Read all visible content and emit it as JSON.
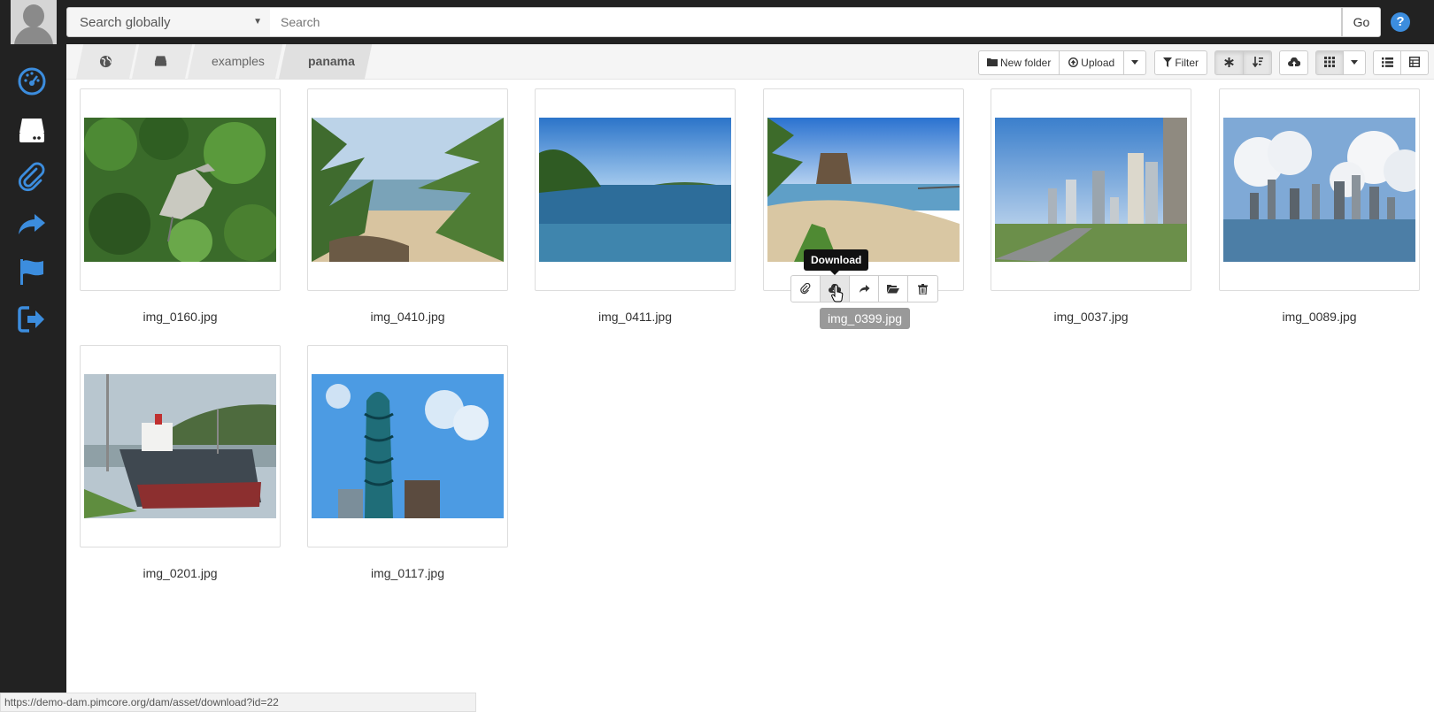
{
  "search": {
    "scope_label": "Search globally",
    "placeholder": "Search",
    "go_label": "Go",
    "help_label": "?"
  },
  "sidebar": {
    "items": [
      {
        "icon": "dashboard-icon"
      },
      {
        "icon": "drive-icon"
      },
      {
        "icon": "paperclip-icon"
      },
      {
        "icon": "share-icon"
      },
      {
        "icon": "flag-icon"
      },
      {
        "icon": "logout-icon"
      }
    ]
  },
  "breadcrumb": {
    "items": [
      {
        "icon": "globe-icon"
      },
      {
        "icon": "drive-icon"
      },
      {
        "label": "examples"
      },
      {
        "label": "panama"
      }
    ]
  },
  "toolbar": {
    "new_folder_label": "New folder",
    "upload_label": "Upload",
    "filter_label": "Filter"
  },
  "assets": [
    {
      "name": "img_0160.jpg",
      "scene": "heron"
    },
    {
      "name": "img_0410.jpg",
      "scene": "palms"
    },
    {
      "name": "img_0411.jpg",
      "scene": "bay"
    },
    {
      "name": "img_0399.jpg",
      "scene": "beach",
      "selected": true
    },
    {
      "name": "img_0037.jpg",
      "scene": "city-road"
    },
    {
      "name": "img_0089.jpg",
      "scene": "skyline"
    },
    {
      "name": "img_0201.jpg",
      "scene": "ship"
    },
    {
      "name": "img_0117.jpg",
      "scene": "tower"
    }
  ],
  "hover_actions": [
    {
      "icon": "paperclip-icon"
    },
    {
      "icon": "download-icon"
    },
    {
      "icon": "share-icon"
    },
    {
      "icon": "folder-open-icon"
    },
    {
      "icon": "trash-icon"
    }
  ],
  "tooltip": {
    "text": "Download"
  },
  "status_url": "https://demo-dam.pimcore.org/dam/asset/download?id=22",
  "colors": {
    "accent": "#3c8dde",
    "dark": "#222222"
  }
}
